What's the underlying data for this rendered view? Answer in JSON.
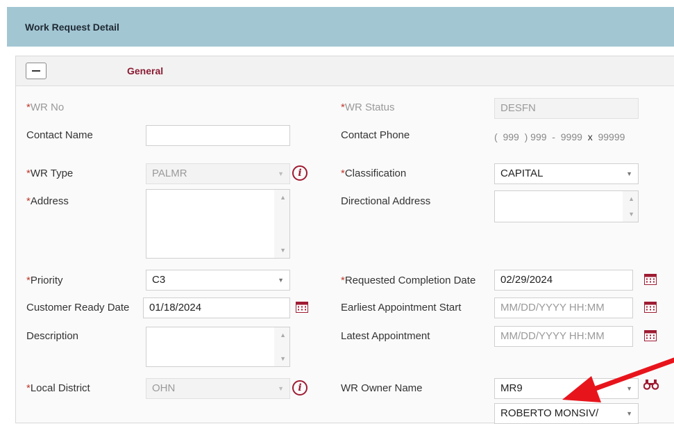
{
  "header": {
    "title": "Work Request Detail"
  },
  "section": {
    "title": "General"
  },
  "fields": {
    "wr_no": {
      "label": "WR No"
    },
    "wr_status": {
      "label": "WR Status",
      "value": "DESFN"
    },
    "contact_name": {
      "label": "Contact Name",
      "value": ""
    },
    "contact_phone": {
      "label": "Contact Phone",
      "open_paren": "(",
      "area": "999",
      "close_paren": ")",
      "prefix": "999",
      "dash": "-",
      "line": "9999",
      "ext_sep": "x",
      "ext": "99999"
    },
    "wr_type": {
      "label": "WR Type",
      "value": "PALMR"
    },
    "classification": {
      "label": "Classification",
      "value": "CAPITAL"
    },
    "address": {
      "label": "Address"
    },
    "directional_address": {
      "label": "Directional Address"
    },
    "priority": {
      "label": "Priority",
      "value": "C3"
    },
    "requested_completion_date": {
      "label": "Requested Completion Date",
      "value": "02/29/2024"
    },
    "customer_ready_date": {
      "label": "Customer Ready Date",
      "value": "01/18/2024"
    },
    "earliest_appointment_start": {
      "label": "Earliest Appointment Start",
      "placeholder": "MM/DD/YYYY HH:MM"
    },
    "description": {
      "label": "Description"
    },
    "latest_appointment": {
      "label": "Latest Appointment",
      "placeholder": "MM/DD/YYYY HH:MM"
    },
    "local_district": {
      "label": "Local District",
      "value": "OHN"
    },
    "wr_owner_name": {
      "label": "WR Owner Name",
      "value": "MR9",
      "name_value": "ROBERTO  MONSIV/"
    }
  },
  "required_marker": "*",
  "colors": {
    "header_bg": "#a3c6d3",
    "section_title": "#8a1c33",
    "required": "#c0392b",
    "arrow": "#e8141c",
    "icon": "#9e1b32"
  },
  "icons": [
    "minus-icon",
    "info-icon",
    "calendar-icon",
    "binoculars-icon",
    "caret-down-icon",
    "arrow-annotation"
  ]
}
